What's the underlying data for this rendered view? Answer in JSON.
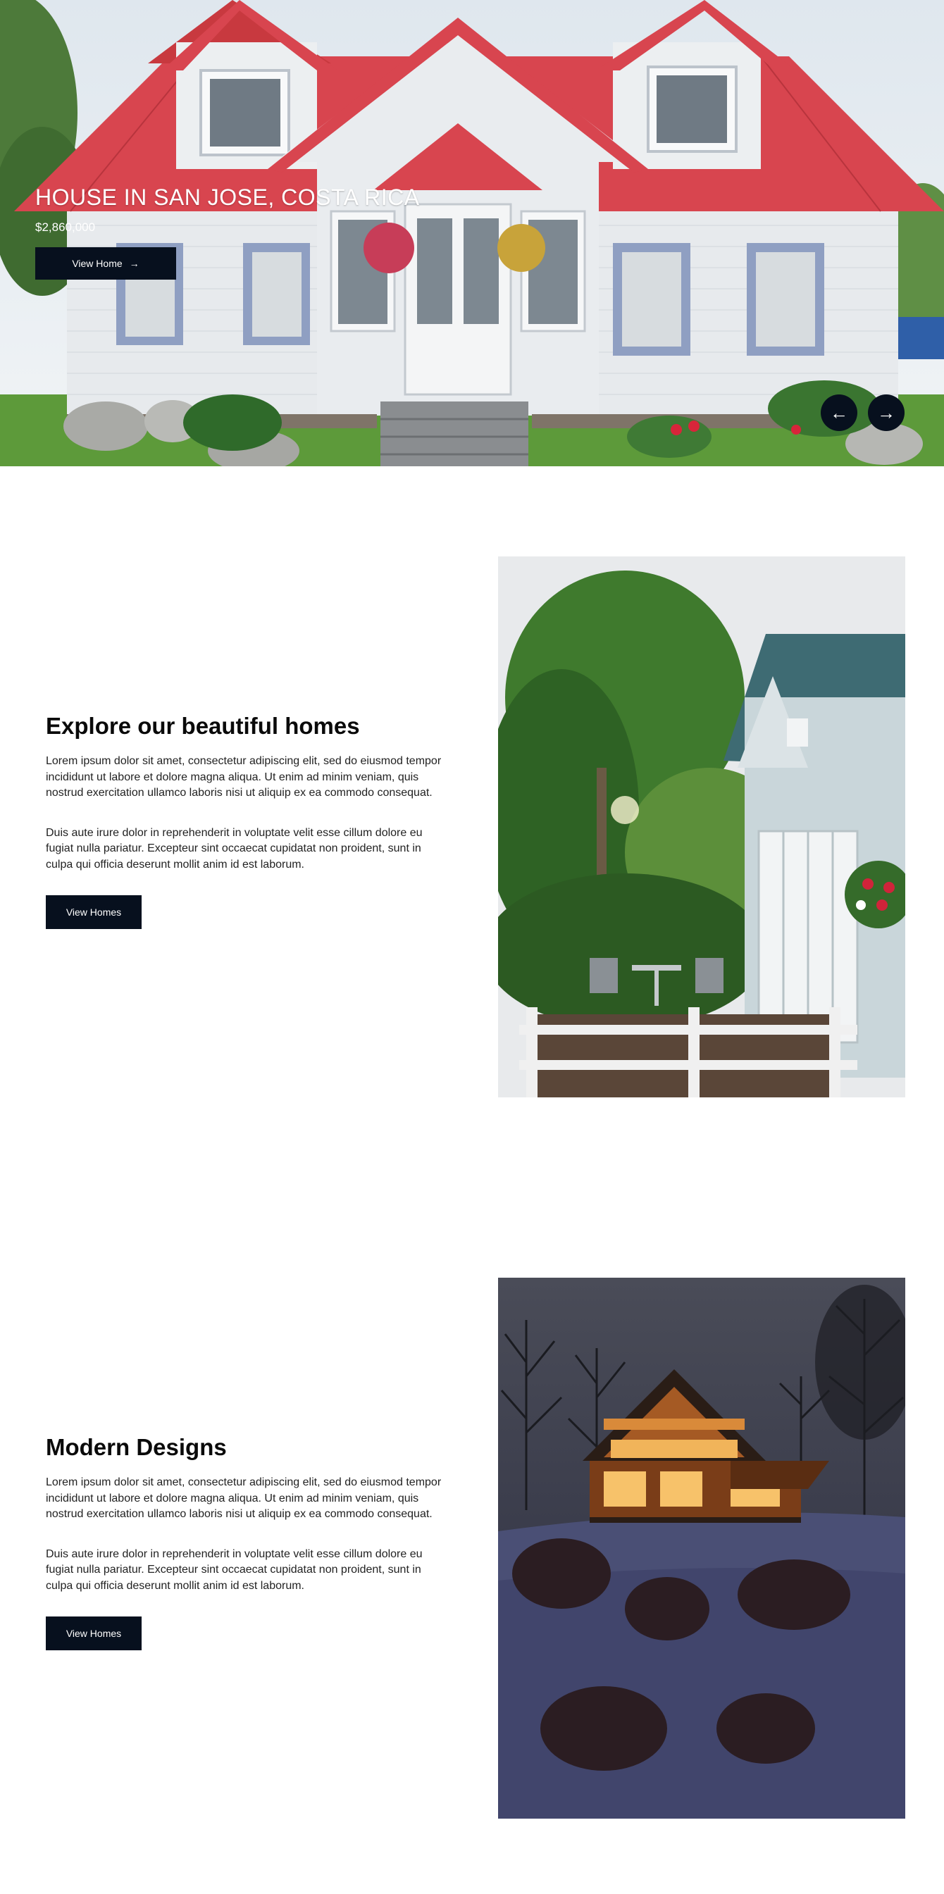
{
  "hero": {
    "title": "HOUSE IN SAN JOSE, COSTA RICA",
    "price": "$2,860,000",
    "button_label": "View Home",
    "button_arrow": "→",
    "prev_icon": "←",
    "next_icon": "→"
  },
  "sections": [
    {
      "title": "Explore our beautiful homes",
      "paragraph1": "Lorem ipsum dolor sit amet, consectetur adipiscing elit, sed do eiusmod tempor incididunt ut labore et dolore magna aliqua. Ut enim ad minim veniam, quis nostrud exercitation ullamco laboris nisi ut aliquip ex ea commodo consequat.",
      "paragraph2": "Duis aute irure dolor in reprehenderit in voluptate velit esse cillum dolore eu fugiat nulla pariatur. Excepteur sint occaecat cupidatat non proident, sunt in culpa qui officia deserunt mollit anim id est laborum.",
      "button_label": "View Homes"
    },
    {
      "title": "Modern Designs",
      "paragraph1": "Lorem ipsum dolor sit amet, consectetur adipiscing elit, sed do eiusmod tempor incididunt ut labore et dolore magna aliqua. Ut enim ad minim veniam, quis nostrud exercitation ullamco laboris nisi ut aliquip ex ea commodo consequat.",
      "paragraph2": "Duis aute irure dolor in reprehenderit in voluptate velit esse cillum dolore eu fugiat nulla pariatur. Excepteur sint occaecat cupidatat non proident, sunt in culpa qui officia deserunt mollit anim id est laborum.",
      "button_label": "View Homes"
    }
  ],
  "colors": {
    "accent_dark": "#07101e",
    "roof_red": "#d8454f",
    "house_white": "#e9ecef"
  },
  "icons": {
    "hero_prev": "arrow-left-icon",
    "hero_next": "arrow-right-icon",
    "hero_button": "arrow-right-icon"
  }
}
